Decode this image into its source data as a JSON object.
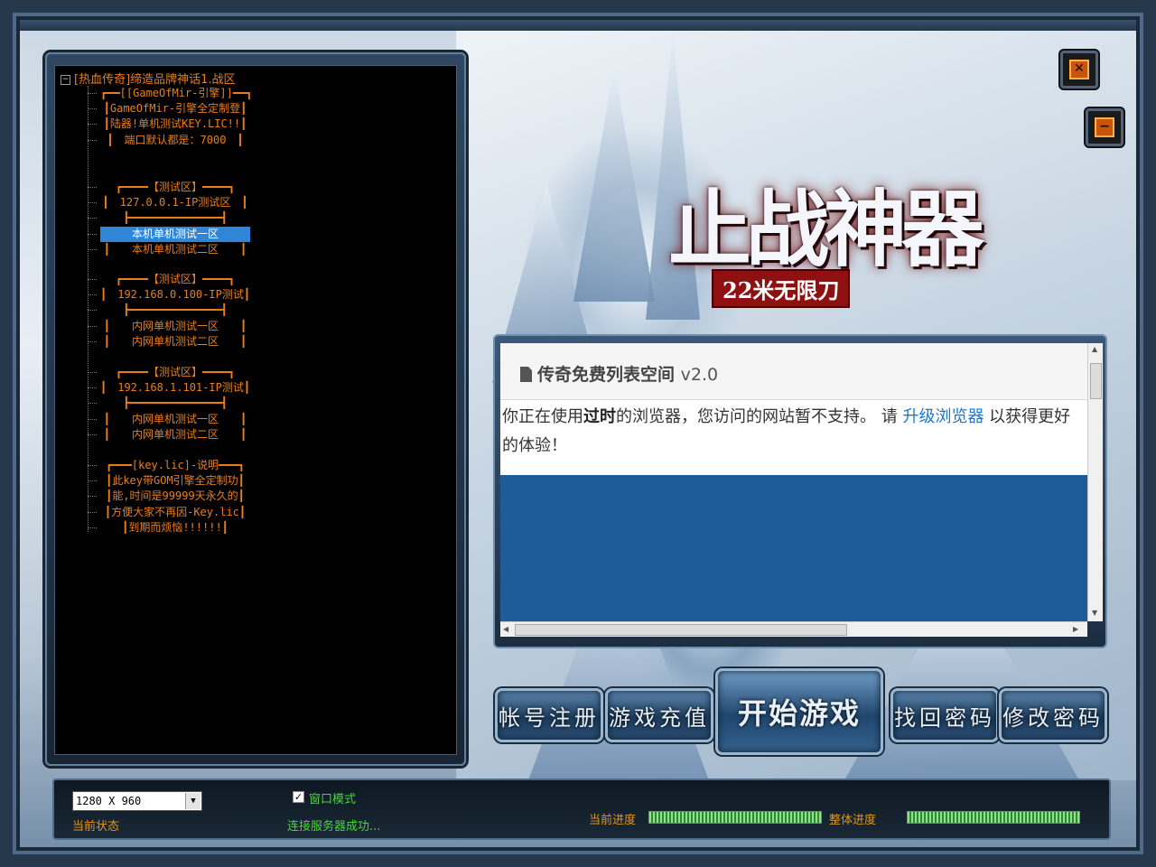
{
  "window": {
    "close_icon": "close-icon",
    "minimize_icon": "minimize-icon"
  },
  "logo": {
    "title": "止战神器",
    "subtitle": "22米无限刀"
  },
  "server_tree": {
    "root": "[热血传奇]缔造品牌神话1.战区",
    "nodes": [
      "┏━━[[GameOfMir-引擎]]━━┓",
      "┃GameOfMir-引擎全定制登┃",
      "┃陆器!单机测试KEY.LIC!!┃",
      "┃　端口默认都是：7000　┃",
      "┏━━━━【测试区】━━━━┓",
      "┃　127.0.0.1-IP测试区　┃",
      "┣━━━━━━━━━━━━━━┫",
      "本机单机测试一区",
      "┃　　本机单机测试二区　　┃",
      "┏━━━━【测试区】━━━━┓",
      "┃　192.168.0.100-IP测试┃",
      "┣━━━━━━━━━━━━━━┫",
      "┃　　内网单机测试一区　　┃",
      "┃　　内网单机测试二区　　┃",
      "┏━━━━【测试区】━━━━┓",
      "┃　192.168.1.101-IP测试┃",
      "┣━━━━━━━━━━━━━━┫",
      "┃　　内网单机测试一区　　┃",
      "┃　　内网单机测试二区　　┃",
      "┏━━━[key.lic]-说明━━━┓",
      "┃此key带GOM引擎全定制功┃",
      "┃能,时间是99999天永久的┃",
      "┃方便大家不再因-Key.lic┃",
      "┃到期而烦恼!!!!!!┃"
    ],
    "selected_index": 7
  },
  "web_panel": {
    "title": "传奇免费列表空间",
    "version": "v2.0",
    "msg_prefix": "你正在使用",
    "msg_bold": "过时",
    "msg_middle": "的浏览器，您访问的网站暂不支持。 请 ",
    "msg_link": "升级浏览器",
    "msg_suffix": " 以获得更好的体验！"
  },
  "buttons": {
    "register": "帐号注册",
    "recharge": "游戏充值",
    "start": "开始游戏",
    "recover": "找回密码",
    "change_password": "修改密码"
  },
  "status_bar": {
    "resolution": "1280 X 960",
    "status_label": "当前状态",
    "window_mode_label": "窗口模式",
    "window_mode_checked": true,
    "connection_status": "连接服务器成功...",
    "current_progress_label": "当前进度",
    "overall_progress_label": "整体进度",
    "current_progress": 1.0,
    "overall_progress": 1.0
  }
}
